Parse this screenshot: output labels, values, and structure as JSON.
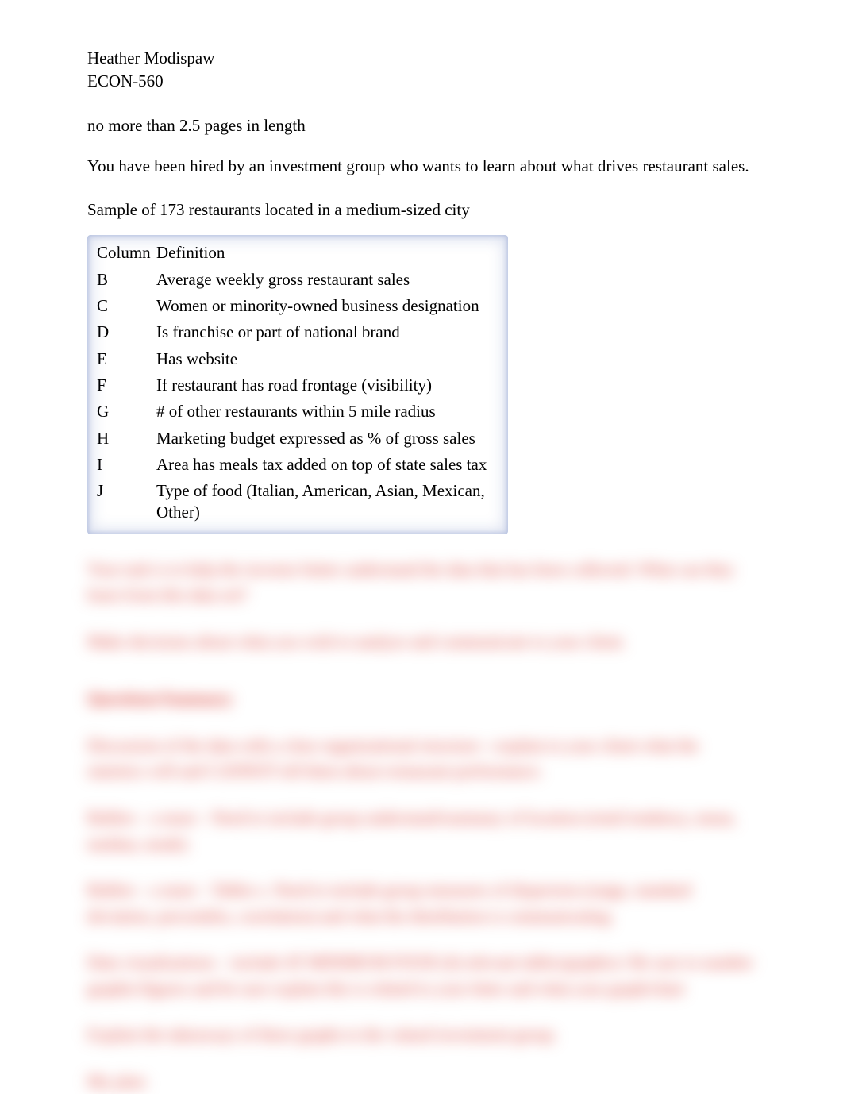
{
  "header": {
    "name": "Heather Modispaw",
    "course": "ECON-560"
  },
  "length_note": "no more than 2.5 pages in length",
  "intro": "You have been hired by an investment group who wants to learn about what drives restaurant sales.",
  "sample_line": "Sample of 173 restaurants located in a medium-sized city",
  "table": {
    "headers": {
      "col": "Column",
      "def": "Definition"
    },
    "rows": [
      {
        "col": "B",
        "def": "Average weekly gross restaurant sales"
      },
      {
        "col": "C",
        "def": "Women or minority-owned business designation"
      },
      {
        "col": "D",
        "def": "Is franchise or part of national brand"
      },
      {
        "col": "E",
        "def": "Has website"
      },
      {
        "col": "F",
        "def": "If restaurant has road frontage (visibility)"
      },
      {
        "col": "G",
        "def": "# of other restaurants within 5 mile radius"
      },
      {
        "col": "H",
        "def": "Marketing budget expressed as % of gross sales"
      },
      {
        "col": "I",
        "def": "Area has meals tax added on top of state sales tax"
      },
      {
        "col": "J",
        "def": "Type of food (Italian, American, Asian, Mexican, Other)"
      }
    ]
  },
  "blurred": {
    "p1": "Your task is to help the investor better understand the data that has been collected. What can they learn from this data set?",
    "p2": "Make decisions about what you wish to analyze and communicate to your client.",
    "p3": "Questions/Summary",
    "p4": "Discussion of the data with a clear organizational structure—explain to your client what the statistics will and CANNOT tell them about restaurant performance.",
    "p5": "Bullets – a must – Need to include group understand/summary of location (retail tendency, mean, median, mode)",
    "p6": "Bullets – a must – Tables s. Need to include group measures of dispersion (range, standard deviation, percentiles, correlation) and what the distribution is communicating.",
    "p7": "Data visualizations – include AT MINIMUM FOUR (4) relevant tables/graphics/          Be sure to number graphic/figures and be sure explain            this is related to your letter and what your graph/chart",
    "p8": "Explain the takeaways of these graphs to the valued investment group.",
    "p9": "My plan:"
  }
}
